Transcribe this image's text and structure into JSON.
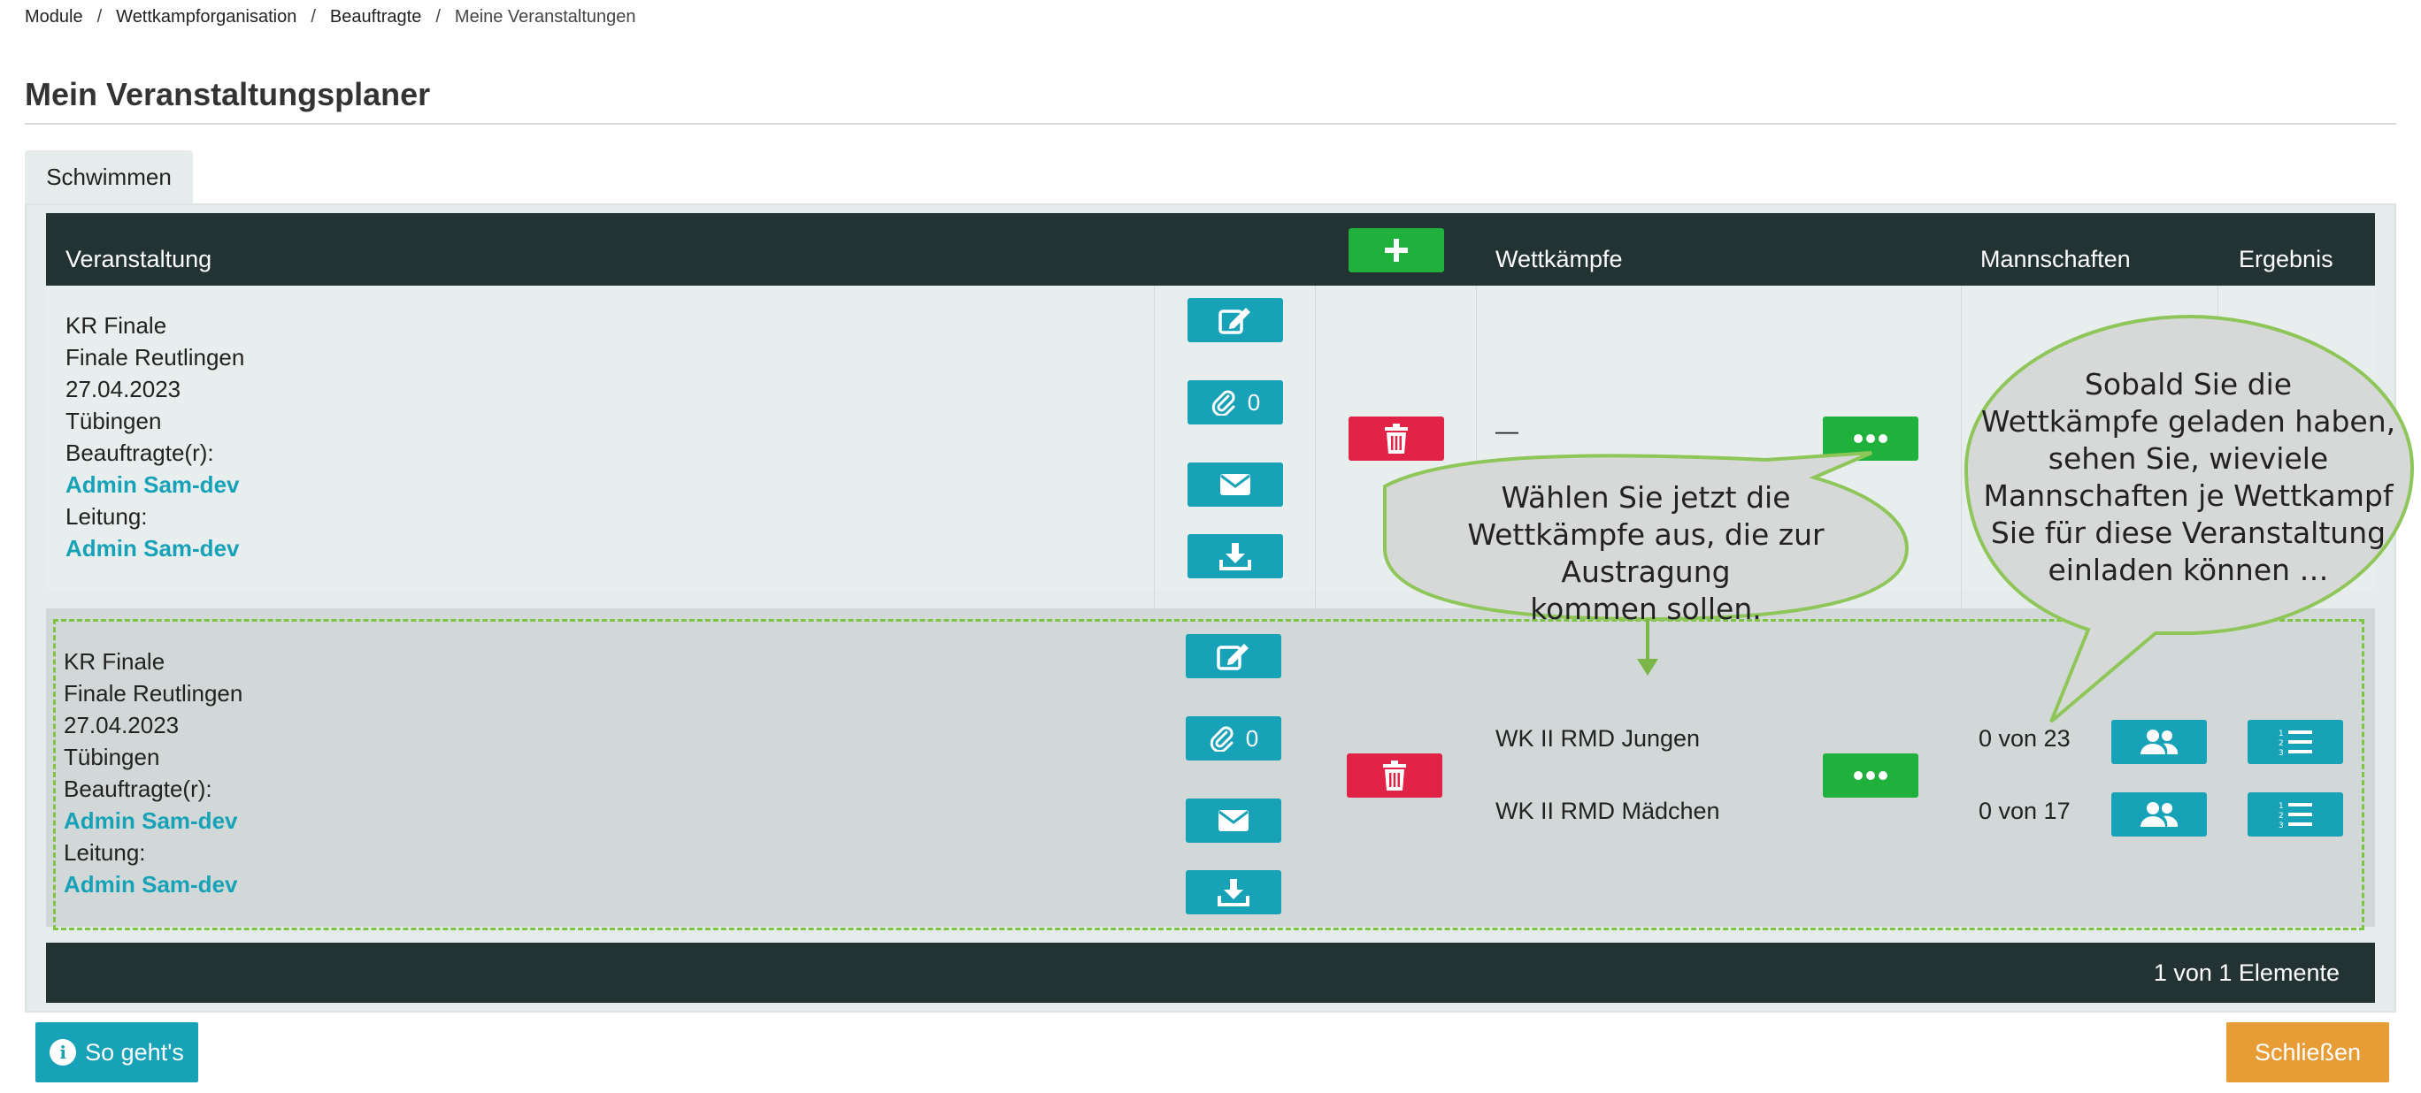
{
  "breadcrumb": {
    "items": [
      "Module",
      "Wettkampforganisation",
      "Beauftragte",
      "Meine Veranstaltungen"
    ],
    "separator": "/"
  },
  "page": {
    "title": "Mein Veranstaltungsplaner"
  },
  "tabs": [
    {
      "label": "Schwimmen",
      "active": true
    }
  ],
  "table": {
    "headers": {
      "veranstaltung": "Veranstaltung",
      "wettkaempfe": "Wettkämpfe",
      "mannschaften": "Mannschaften",
      "ergebnis": "Ergebnis"
    },
    "rows": [
      {
        "name": "KR Finale",
        "event": "Finale Reutlingen",
        "date": "27.04.2023",
        "place": "Tübingen",
        "beauftragte_label": "Beauftragte(r):",
        "beauftragte": "Admin Sam-dev",
        "leitung_label": "Leitung:",
        "leitung": "Admin Sam-dev",
        "attachments": "0",
        "wettkaempfe_empty": "—"
      },
      {
        "name": "KR Finale",
        "event": "Finale Reutlingen",
        "date": "27.04.2023",
        "place": "Tübingen",
        "beauftragte_label": "Beauftragte(r):",
        "beauftragte": "Admin Sam-dev",
        "leitung_label": "Leitung:",
        "leitung": "Admin Sam-dev",
        "attachments": "0",
        "wettkaempfe": [
          {
            "name": "WK II RMD Jungen",
            "teams": "0 von 23"
          },
          {
            "name": "WK II RMD Mädchen",
            "teams": "0 von 17"
          }
        ]
      }
    ],
    "footer": "1 von 1 Elemente"
  },
  "callouts": {
    "left": [
      "Wählen Sie jetzt die",
      "Wettkämpfe aus, die zur Austragung",
      "kommen sollen."
    ],
    "right": [
      "Sobald Sie die",
      "Wettkämpfe geladen haben,",
      "sehen Sie, wieviele",
      "Mannschaften je Wettkampf",
      "Sie für diese Veranstaltung",
      "einladen können …"
    ]
  },
  "buttons": {
    "how": "So geht's",
    "close": "Schließen"
  },
  "icons": [
    "edit-icon",
    "paperclip-icon",
    "envelope-icon",
    "download-icon",
    "trash-icon",
    "plus-icon",
    "ellipsis-icon",
    "users-icon",
    "list-ol-icon",
    "info-icon"
  ],
  "colors": {
    "header": "#233333",
    "teal": "#17a2b8",
    "red": "#e02346",
    "green": "#20b13c",
    "orange": "#e89c36",
    "highlight": "#7ec343"
  }
}
